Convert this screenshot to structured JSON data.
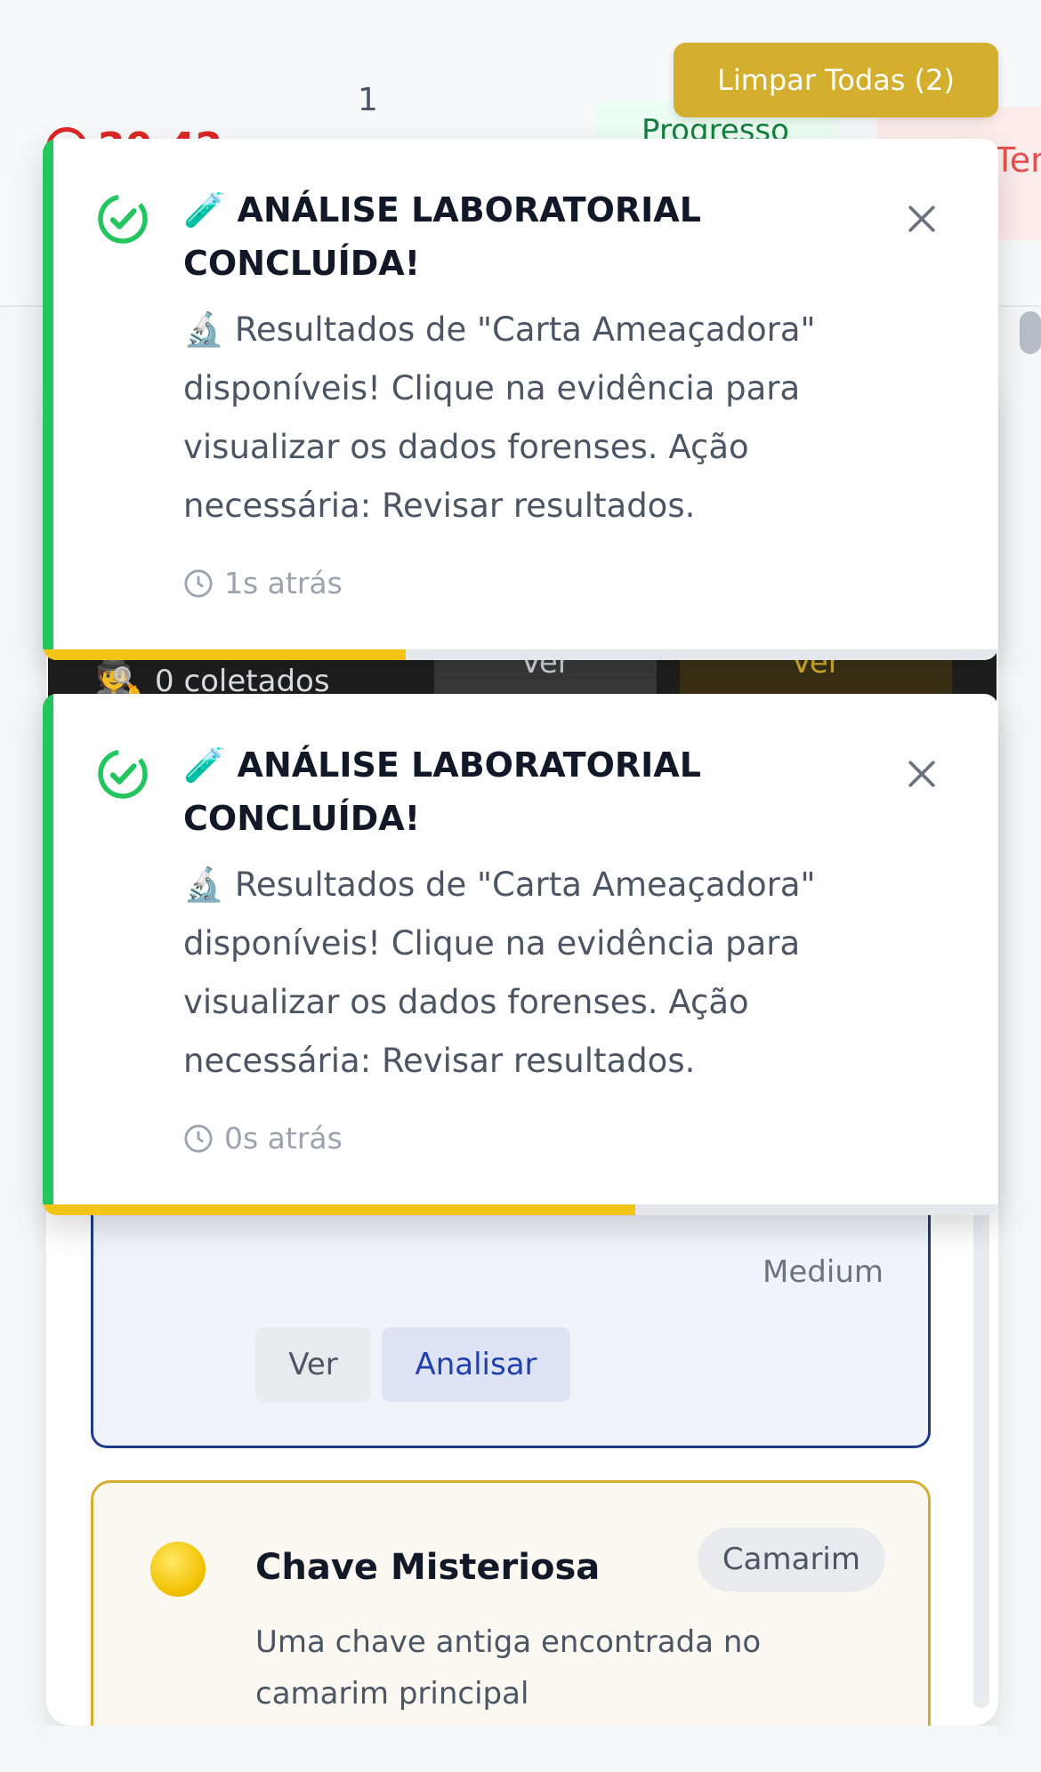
{
  "header": {
    "count": "1",
    "timer": "20:42",
    "progress_label": "Progresso",
    "alert_label": "Tens N",
    "clear_all_label": "Limpar Todas (2)"
  },
  "dashboard": {
    "dark_row_text": "0 coletados",
    "dark_btn_view1": "Ver",
    "dark_btn_view2": "Ver"
  },
  "evidence_card": {
    "priority": "Medium",
    "view_label": "Ver",
    "analyze_label": "Analisar"
  },
  "key_card": {
    "title": "Chave Misteriosa",
    "location_tag": "Camarim",
    "description": "Uma chave antiga encontrada no camarim principal"
  },
  "notifications": [
    {
      "title": "🧪 ANÁLISE LABORATORIAL CONCLUÍDA!",
      "body": "🔬 Resultados de \"Carta Ameaçadora\" disponíveis! Clique na evidência para visualizar os dados forenses. Ação necessária: Revisar resultados.",
      "time": "1s atrás",
      "progress": 0.38
    },
    {
      "title": "🧪 ANÁLISE LABORATORIAL CONCLUÍDA!",
      "body": "🔬 Resultados de \"Carta Ameaçadora\" disponíveis! Clique na evidência para visualizar os dados forenses. Ação necessária: Revisar resultados.",
      "time": "0s atrás",
      "progress": 0.62
    }
  ],
  "colors": {
    "success": "#22c55e",
    "gold": "#d4ae2e",
    "progress_bar": "#f3c315"
  }
}
